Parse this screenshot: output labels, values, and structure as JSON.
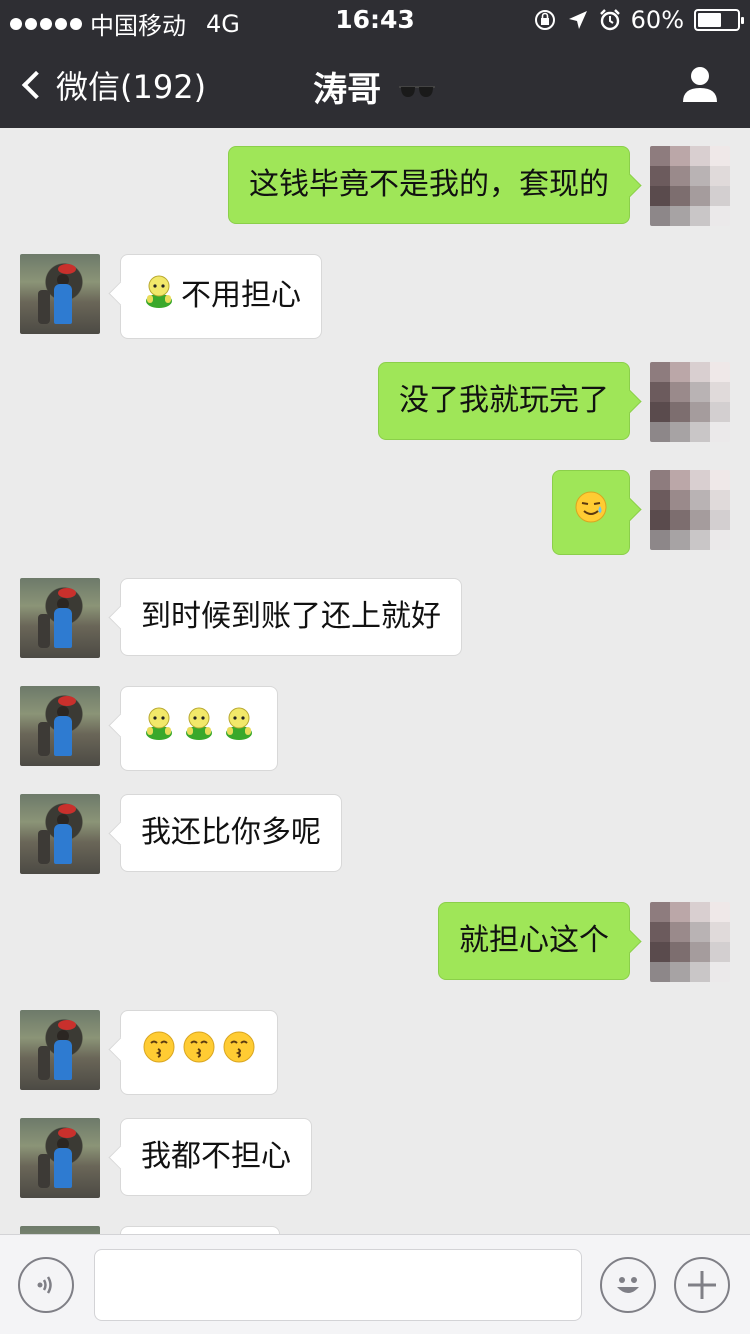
{
  "status_bar": {
    "carrier": "中国移动",
    "network": "4G",
    "time": "16:43",
    "battery": "60%",
    "battery_level": 0.6
  },
  "nav": {
    "back_label": "微信(192)",
    "title": "涛哥",
    "icons": [
      "chevron-left-icon",
      "sunglasses-icon",
      "profile-icon"
    ]
  },
  "colors": {
    "bar_bg": "#2e2e33",
    "chat_bg": "#ebebeb",
    "outgoing_bubble": "#9fe658",
    "incoming_bubble": "#ffffff"
  },
  "messages": [
    {
      "side": "right",
      "text": "这钱毕竟不是我的，套现的",
      "emoji": "",
      "emoji_count": 0
    },
    {
      "side": "left",
      "text": "不用担心",
      "emoji": "green-bear-emoji",
      "emoji_count": 1
    },
    {
      "side": "right",
      "text": "没了我就玩完了",
      "emoji": "",
      "emoji_count": 0
    },
    {
      "side": "right",
      "text": "",
      "emoji": "sweat-smile-emoji",
      "emoji_count": 1
    },
    {
      "side": "left",
      "text": "到时候到账了还上就好",
      "emoji": "",
      "emoji_count": 0
    },
    {
      "side": "left",
      "text": "",
      "emoji": "green-bear-emoji",
      "emoji_count": 3
    },
    {
      "side": "left",
      "text": "我还比你多呢",
      "emoji": "",
      "emoji_count": 0
    },
    {
      "side": "right",
      "text": "就担心这个",
      "emoji": "",
      "emoji_count": 0
    },
    {
      "side": "left",
      "text": "",
      "emoji": "kiss-emoji",
      "emoji_count": 3
    },
    {
      "side": "left",
      "text": "我都不担心",
      "emoji": "",
      "emoji_count": 0
    }
  ],
  "input_bar": {
    "placeholder": "",
    "icons": [
      "voice-icon",
      "emoji-smile-icon",
      "plus-icon"
    ]
  }
}
